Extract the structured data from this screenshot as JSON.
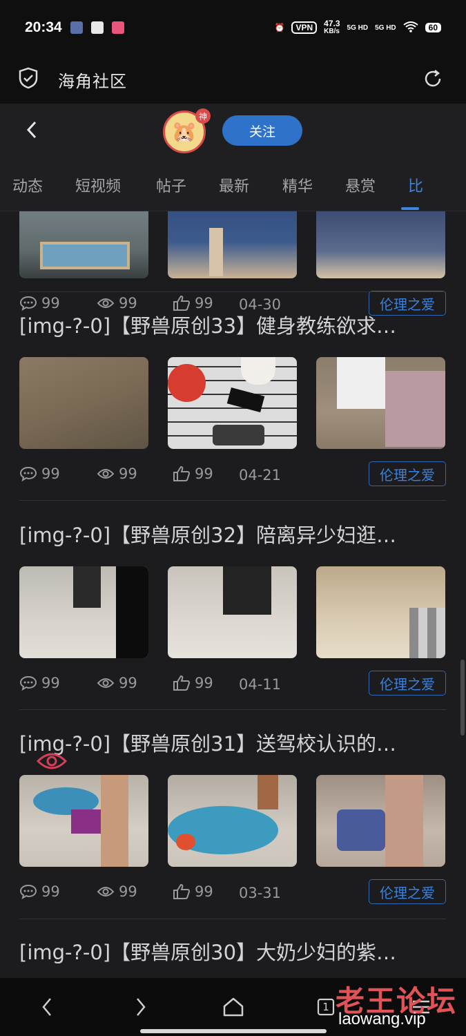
{
  "status_bar": {
    "time": "20:34",
    "vpn": "VPN",
    "speed": "47.3",
    "speed_unit": "KB/s",
    "net1": "5G HD",
    "net2": "5G HD",
    "battery": "60"
  },
  "appbar": {
    "title": "海角社区",
    "shield_icon": "shield-check-icon",
    "refresh_icon": "refresh-icon"
  },
  "header": {
    "follow_label": "关注",
    "avatar_badge": "神"
  },
  "tabs": [
    {
      "label": "动态"
    },
    {
      "label": "短视频"
    },
    {
      "label": "帖子"
    },
    {
      "label": "最新"
    },
    {
      "label": "精华"
    },
    {
      "label": "悬赏"
    },
    {
      "label": "比"
    }
  ],
  "active_tab": 6,
  "accent_color": "#3d86e0",
  "posts": [
    {
      "title": "",
      "comments": "99",
      "views": "99",
      "likes": "99",
      "date": "04-30",
      "tag": "伦理之爱"
    },
    {
      "title": "[img-?-0]【野兽原创33】健身教练欲求…",
      "comments": "99",
      "views": "99",
      "likes": "99",
      "date": "04-21",
      "tag": "伦理之爱"
    },
    {
      "title": "[img-?-0]【野兽原创32】陪离异少妇逛…",
      "comments": "99",
      "views": "99",
      "likes": "99",
      "date": "04-11",
      "tag": "伦理之爱"
    },
    {
      "title": "[img-?-0]【野兽原创31】送驾校认识的…",
      "comments": "99",
      "views": "99",
      "likes": "99",
      "date": "03-31",
      "tag": "伦理之爱"
    },
    {
      "title": "[img-?-0]【野兽原创30】大奶少妇的紫…",
      "comments": "",
      "views": "",
      "likes": "",
      "date": "",
      "tag": ""
    }
  ],
  "watermark": {
    "cn": "老王论坛",
    "url": "laowang.vip"
  },
  "navbar": {
    "tabs_count": "1"
  }
}
